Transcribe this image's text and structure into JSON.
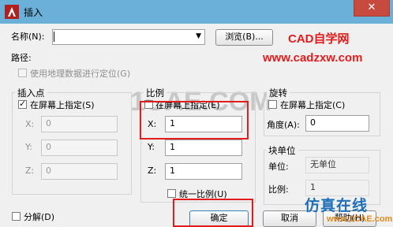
{
  "window": {
    "title": "插入",
    "close_glyph": "✕"
  },
  "name_row": {
    "label": "名称(N):",
    "value": "",
    "browse_button": "浏览(B)..."
  },
  "path": {
    "label": "路径:",
    "geo_checkbox": "使用地理数据进行定位(G)"
  },
  "insertion": {
    "legend": "插入点",
    "specify_checkbox": "在屏幕上指定(S)",
    "x_label": "X:",
    "x_value": "0",
    "y_label": "Y:",
    "y_value": "0",
    "z_label": "Z:",
    "z_value": "0"
  },
  "scale": {
    "legend": "比例",
    "specify_checkbox": "在屏幕上指定(E)",
    "x_label": "X:",
    "x_value": "1",
    "y_label": "Y:",
    "y_value": "1",
    "z_label": "Z:",
    "z_value": "1",
    "uniform_checkbox": "统一比例(U)"
  },
  "rotation": {
    "legend": "旋转",
    "specify_checkbox": "在屏幕上指定(C)",
    "angle_label": "角度(A):",
    "angle_value": "0"
  },
  "block_unit": {
    "legend": "块单位",
    "unit_label": "单位:",
    "unit_value": "无单位",
    "factor_label": "比例:",
    "factor_value": "1"
  },
  "explode_checkbox": "分解(D)",
  "buttons": {
    "ok": "确定",
    "cancel": "取消",
    "help": "帮助(H)"
  },
  "watermark": {
    "brand_title": "CAD自学网",
    "brand_url": "www.cadzxw.com",
    "bg_text": "1CAE.COM",
    "logo_text": "仿真在线",
    "logo_url": "www.1CAE.com"
  },
  "colors": {
    "titlebar": "#6bb0d8",
    "highlight": "#e21c1c",
    "close": "#c74a3e"
  }
}
